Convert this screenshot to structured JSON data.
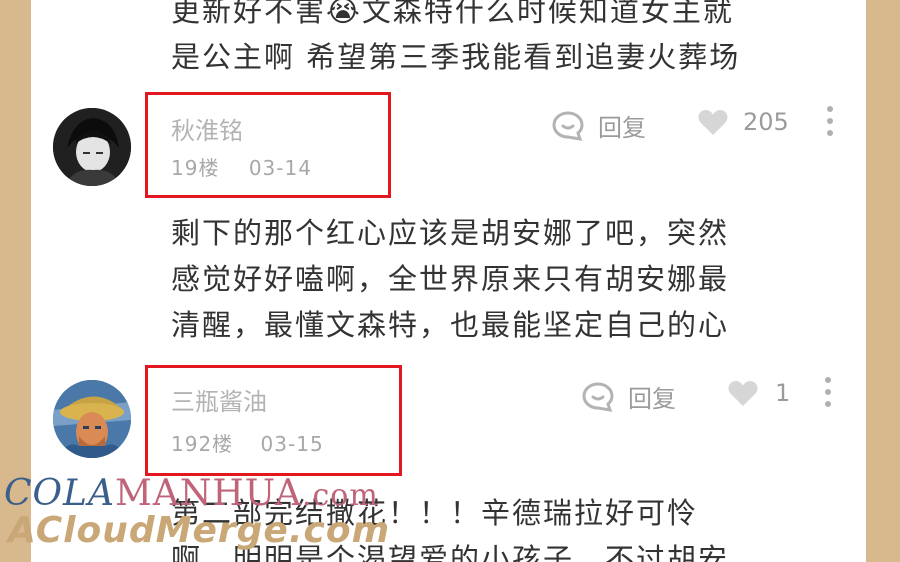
{
  "top_comment": {
    "line1": "更新好不害😭文森特什么时候知道女主就",
    "line2": "是公主啊 希望第三季我能看到追妻火葬场"
  },
  "comments": [
    {
      "username": "秋淮铭",
      "floor": "19楼",
      "date": "03-14",
      "reply_label": "回复",
      "likes": "205",
      "text_lines": [
        "剩下的那个红心应该是胡安娜了吧，突然",
        "感觉好好嗑啊，全世界原来只有胡安娜最",
        "清醒，最懂文森特，也最能坚定自己的心"
      ]
    },
    {
      "username": "三瓶酱油",
      "floor": "192楼",
      "date": "03-15",
      "reply_label": "回复",
      "likes": "1",
      "text_lines": [
        "第二部完结撒花！！！辛德瑞拉好可怜",
        "啊，明明是个渴望爱的小孩子，不过胡安"
      ]
    }
  ],
  "watermark": {
    "line1_part1": "COLA",
    "line1_part2": "MANHUA",
    "line1_part3": ".com",
    "line2": "ACloudMerge.com"
  },
  "colors": {
    "background": "#d7b98d",
    "panel": "#ffffff",
    "highlight_box": "#e3171f",
    "body_text": "#333333",
    "meta_text": "#a8a8a8",
    "watermark_blue": "#3a5f8a",
    "watermark_pink": "#c0647a",
    "watermark_gold": "#c9a776"
  }
}
